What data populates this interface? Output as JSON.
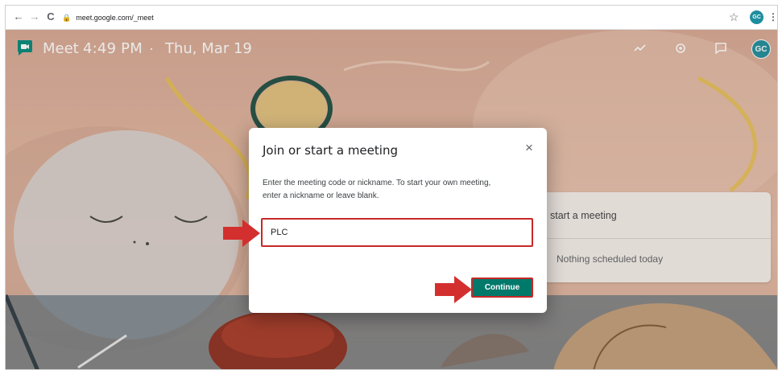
{
  "browser": {
    "url": "meet.google.com/_meet",
    "back_glyph": "←",
    "forward_glyph": "→",
    "reload_glyph": "C",
    "lock_glyph": "🔒",
    "star_glyph": "☆",
    "profile_initials": "GC",
    "menu_glyph": "⋮"
  },
  "meet": {
    "app_name": "Meet",
    "time": "4:49 PM",
    "separator": "·",
    "date": "Thu, Mar 19",
    "header_icons": [
      "activity-icon",
      "settings-icon",
      "feedback-icon"
    ],
    "avatar_initials": "GC"
  },
  "side_card": {
    "start_label": "start a meeting",
    "schedule_label": "Nothing scheduled today"
  },
  "dialog": {
    "title": "Join or start a meeting",
    "close_glyph": "×",
    "body_line1": "Enter the meeting code or nickname. To start your own meeting,",
    "body_line2": "enter a nickname or leave blank.",
    "input_value": "PLC",
    "continue_label": "Continue"
  },
  "colors": {
    "accent_teal": "#00796b",
    "highlight_red": "#c62828",
    "avatar_teal": "#1e8e9e"
  }
}
